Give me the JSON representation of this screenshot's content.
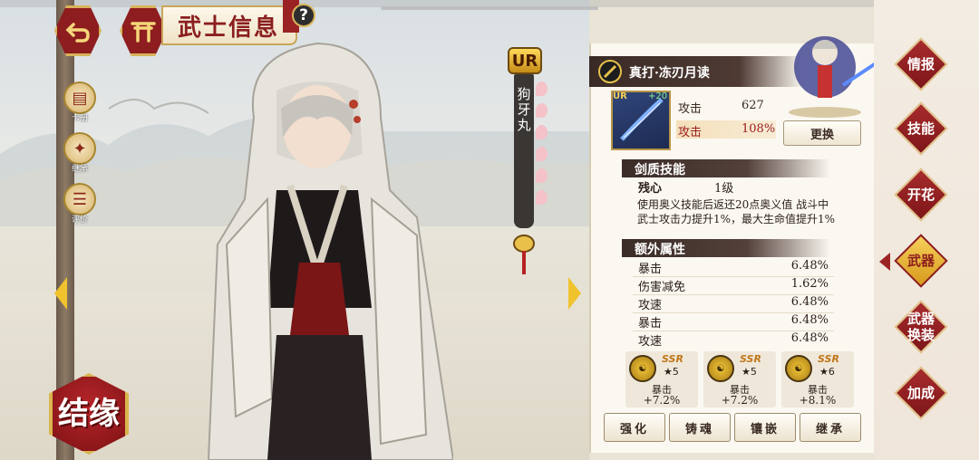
{
  "header": {
    "title": "武士信息",
    "help_symbol": "?"
  },
  "left_menu": {
    "items": [
      {
        "label": "卡册",
        "icon": "card-album-icon"
      },
      {
        "label": "继承",
        "icon": "inherit-icon"
      },
      {
        "label": "评价",
        "icon": "review-icon"
      }
    ],
    "bond_label": "结缘"
  },
  "weapon_tag": {
    "rarity": "UR",
    "name": "狗牙丸"
  },
  "weapon": {
    "title": "真打·冻刃月读",
    "card_rarity": "UR",
    "card_level": "+20",
    "stats": [
      {
        "label": "攻击",
        "value": "627"
      },
      {
        "label": "攻击",
        "value": "108%"
      }
    ],
    "replace_label": "更换"
  },
  "skill": {
    "section_title": "剑质技能",
    "name": "残心",
    "level": "1级",
    "description": "使用奥义技能后返还20点奥义值 战斗中武士攻击力提升1%，最大生命值提升1%"
  },
  "extra": {
    "section_title": "额外属性",
    "rows": [
      {
        "label": "暴击",
        "value": "6.48%"
      },
      {
        "label": "伤害减免",
        "value": "1.62%"
      },
      {
        "label": "攻速",
        "value": "6.48%"
      },
      {
        "label": "暴击",
        "value": "6.48%"
      },
      {
        "label": "攻速",
        "value": "6.48%"
      }
    ]
  },
  "gems": [
    {
      "grade": "SSR",
      "stars": "5",
      "stat": "暴击",
      "value": "+7.2%"
    },
    {
      "grade": "SSR",
      "stars": "5",
      "stat": "暴击",
      "value": "+7.2%"
    },
    {
      "grade": "SSR",
      "stars": "6",
      "stat": "暴击",
      "value": "+8.1%"
    }
  ],
  "actions": [
    "强化",
    "铸魂",
    "镶嵌",
    "继承"
  ],
  "right_menu": {
    "items": [
      "情报",
      "技能",
      "开花",
      "武器",
      "武器换装",
      "加成"
    ],
    "active": "武器"
  },
  "colors": {
    "accent_red": "#8e1d1f",
    "gold": "#d8b35a",
    "highlight_stat": "#9a1c1c"
  }
}
